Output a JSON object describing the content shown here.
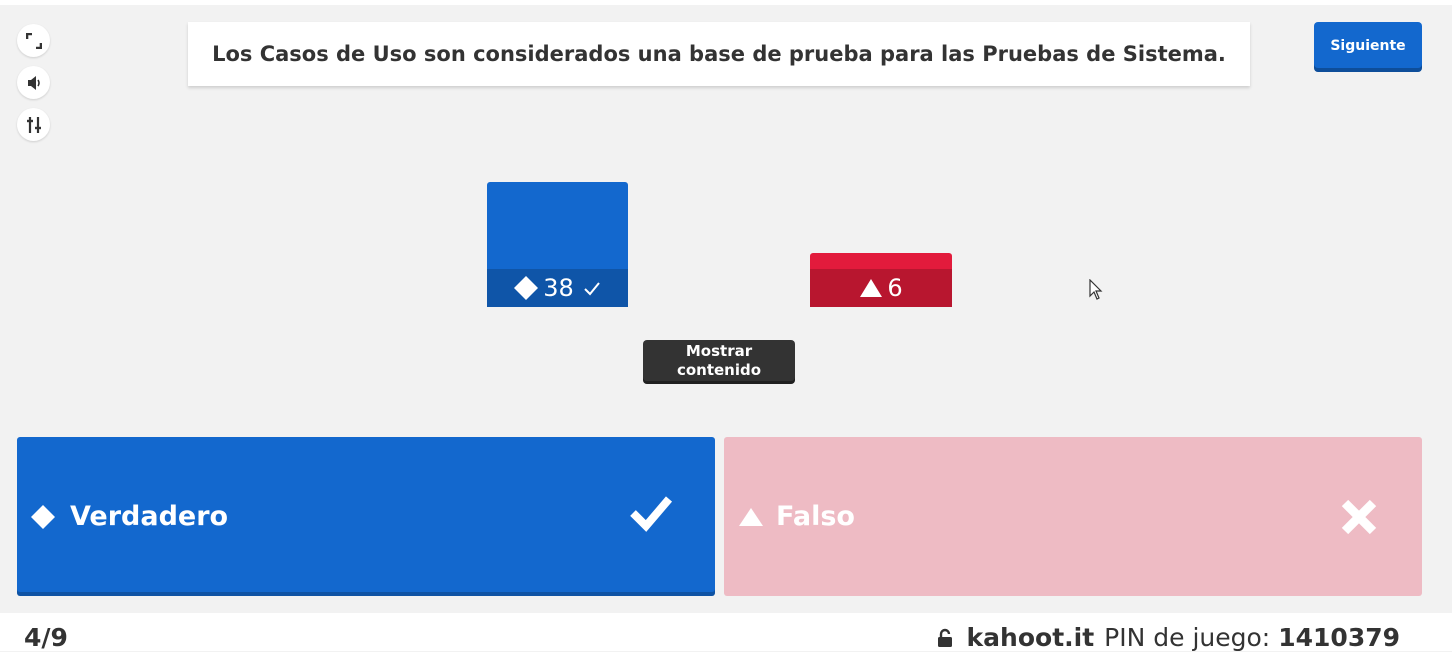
{
  "controls": {
    "fullscreen_icon": "fullscreen-icon",
    "volume_icon": "volume-icon",
    "settings_icon": "sliders-icon"
  },
  "question": {
    "text": "Los Casos de Uso son considerados una base de prueba para las Pruebas de Sistema."
  },
  "next_button": {
    "label": "Siguiente"
  },
  "results": [
    {
      "shape": "diamond",
      "count": "38",
      "correct": true,
      "color": "#1368ce",
      "share_of_max": 1.0
    },
    {
      "shape": "triangle",
      "count": "6",
      "correct": false,
      "color": "#e21b3c",
      "share_of_max": 0.16
    }
  ],
  "show_content_button": {
    "label": "Mostrar contenido"
  },
  "answers": [
    {
      "label": "Verdadero",
      "shape": "diamond",
      "correct": true,
      "color": "#1368ce"
    },
    {
      "label": "Falso",
      "shape": "triangle",
      "correct": false,
      "color": "#eebbc4"
    }
  ],
  "footer": {
    "progress": "4/9",
    "lock_icon": "lock-icon",
    "site": "kahoot.it",
    "pin_label": "PIN de juego:",
    "pin": "1410379"
  }
}
